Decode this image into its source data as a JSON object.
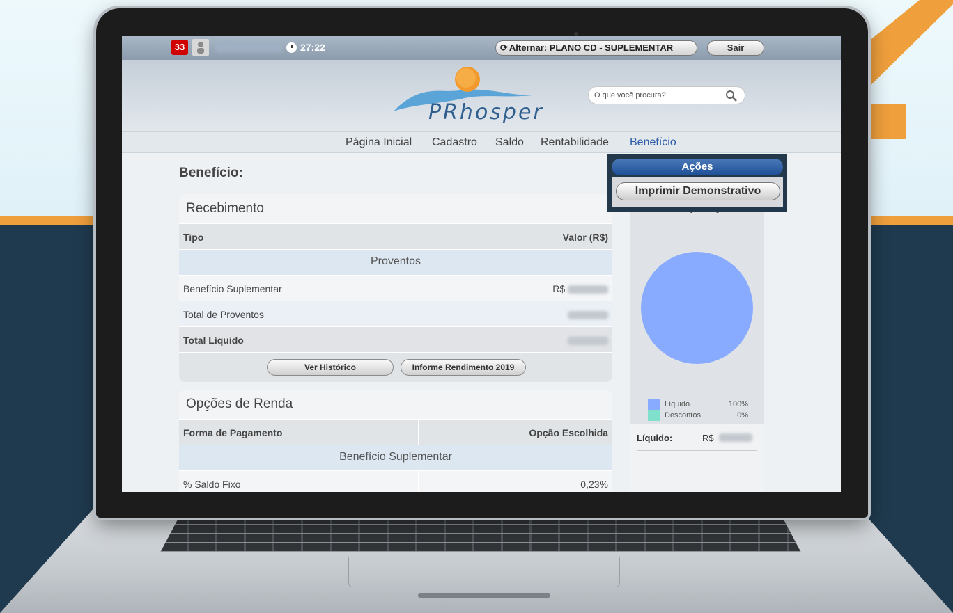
{
  "colors": {
    "accent_orange": "#ef9f3c",
    "dark_navy": "#1f3a4e",
    "brand_blue": "#2c5aa8",
    "pie_liquido": "#88aaff",
    "pie_descontos": "#7fe0cc",
    "badge_red": "#d00000"
  },
  "topbar": {
    "notification_count": "33",
    "timer": "27:22",
    "alternar_label": "Alternar: PLANO CD - SUPLEMENTAR",
    "sair_label": "Sair"
  },
  "header": {
    "logo_text": "PRhosper",
    "search_placeholder": "O que você procura?"
  },
  "nav": {
    "items": [
      "Página Inicial",
      "Cadastro",
      "Saldo",
      "Rentabilidade",
      "Benefício"
    ],
    "active": "Benefício"
  },
  "page": {
    "title": "Benefício:"
  },
  "recebimento": {
    "title": "Recebimento",
    "col_tipo": "Tipo",
    "col_valor": "Valor (R$)",
    "group": "Proventos",
    "rows": [
      {
        "label": "Benefício Suplementar",
        "value": "R$"
      },
      {
        "label": "Total de Proventos",
        "value": ""
      },
      {
        "label": "Total Líquido",
        "value": ""
      }
    ],
    "btn_historico": "Ver Histórico",
    "btn_informe": "Informe Rendimento 2019"
  },
  "opcoes": {
    "title": "Opções de Renda",
    "col_forma": "Forma de Pagamento",
    "col_opcao": "Opção Escolhida",
    "group": "Benefício Suplementar",
    "row_label": "% Saldo Fixo",
    "row_value": "0,23%"
  },
  "composicao": {
    "title": "Composição",
    "legend": [
      {
        "label": "Líquido",
        "value": "100%"
      },
      {
        "label": "Descontos",
        "value": "0%"
      }
    ],
    "liquido_label": "Líquido:",
    "liquido_currency": "R$"
  },
  "acoes": {
    "header": "Ações",
    "imprimir_label": "Imprimir Demonstrativo"
  }
}
